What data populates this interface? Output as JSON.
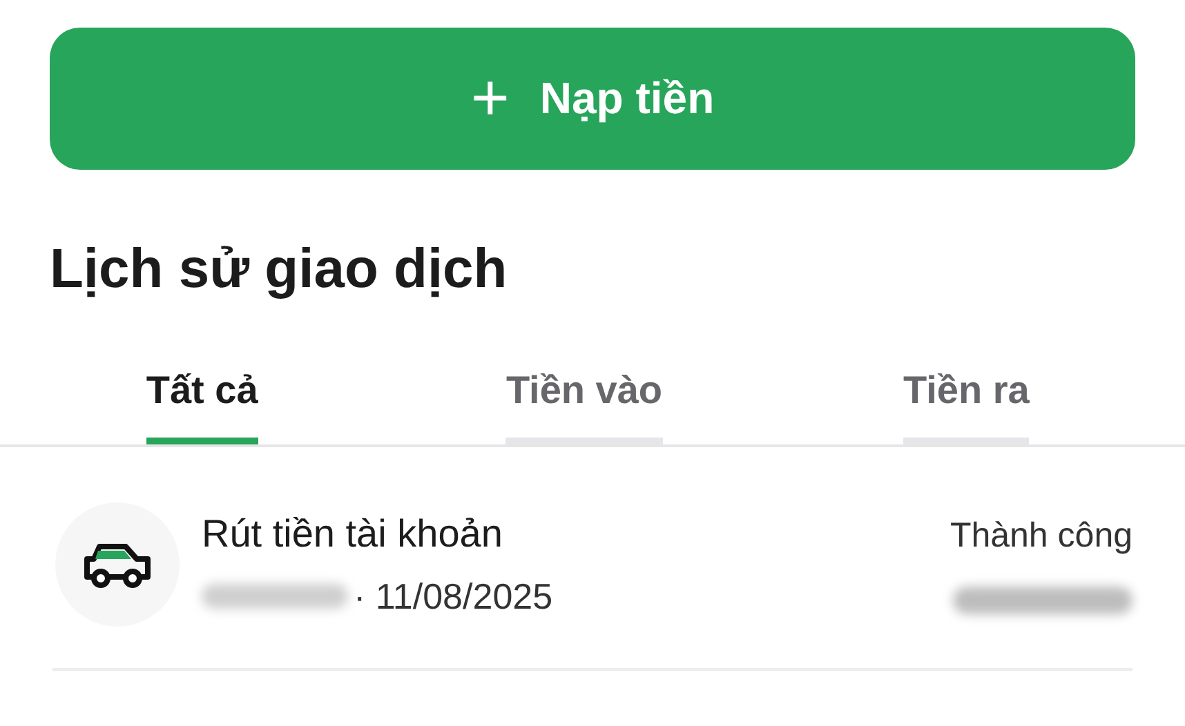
{
  "deposit_button": {
    "icon": "+",
    "label": "Nạp tiền"
  },
  "heading": "Lịch sử giao dịch",
  "tabs": [
    {
      "label": "Tất cả",
      "selected": true
    },
    {
      "label": "Tiền vào",
      "selected": false
    },
    {
      "label": "Tiền ra",
      "selected": false
    }
  ],
  "transactions": [
    {
      "title": "Rút tiền tài khoản",
      "date": "· 11/08/2025",
      "status": "Thành công"
    }
  ]
}
